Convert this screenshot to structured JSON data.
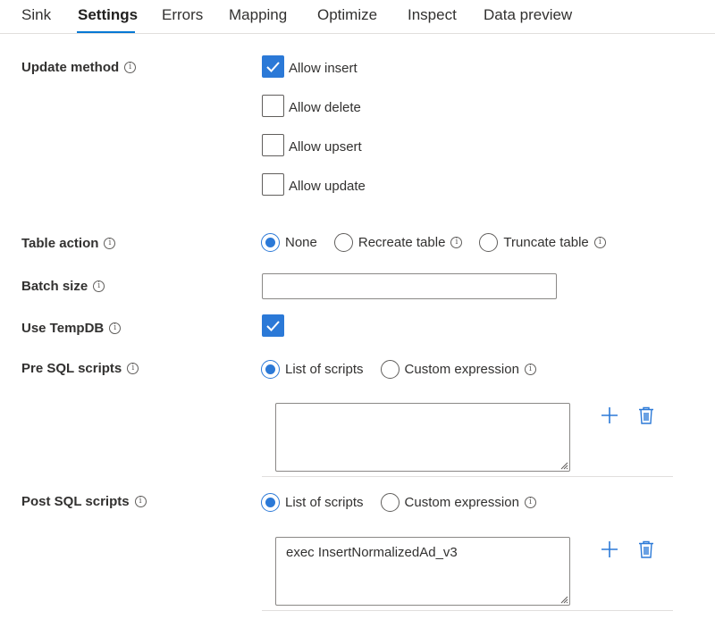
{
  "tabs": [
    {
      "label": "Sink"
    },
    {
      "label": "Settings"
    },
    {
      "label": "Errors"
    },
    {
      "label": "Mapping"
    },
    {
      "label": "Optimize"
    },
    {
      "label": "Inspect"
    },
    {
      "label": "Data preview"
    }
  ],
  "active_tab": "Settings",
  "update_method": {
    "label": "Update method",
    "options": [
      {
        "label": "Allow insert",
        "checked": true
      },
      {
        "label": "Allow delete",
        "checked": false
      },
      {
        "label": "Allow upsert",
        "checked": false
      },
      {
        "label": "Allow update",
        "checked": false
      }
    ]
  },
  "table_action": {
    "label": "Table action",
    "options": [
      {
        "label": "None",
        "selected": true
      },
      {
        "label": "Recreate table",
        "selected": false
      },
      {
        "label": "Truncate table",
        "selected": false
      }
    ]
  },
  "batch_size": {
    "label": "Batch size",
    "value": ""
  },
  "use_tempdb": {
    "label": "Use TempDB",
    "checked": true
  },
  "pre_sql": {
    "label": "Pre SQL scripts",
    "options": [
      {
        "label": "List of scripts",
        "selected": true
      },
      {
        "label": "Custom expression",
        "selected": false
      }
    ],
    "script": ""
  },
  "post_sql": {
    "label": "Post SQL scripts",
    "options": [
      {
        "label": "List of scripts",
        "selected": true
      },
      {
        "label": "Custom expression",
        "selected": false
      }
    ],
    "script": "exec InsertNormalizedAd_v3"
  },
  "colors": {
    "accent": "#0078d4",
    "checkbox_fill": "#2b79d7",
    "border": "#8a8886"
  },
  "icons": {
    "info": "info-icon",
    "add": "plus-icon",
    "delete": "trash-icon",
    "check": "checkmark-icon"
  }
}
